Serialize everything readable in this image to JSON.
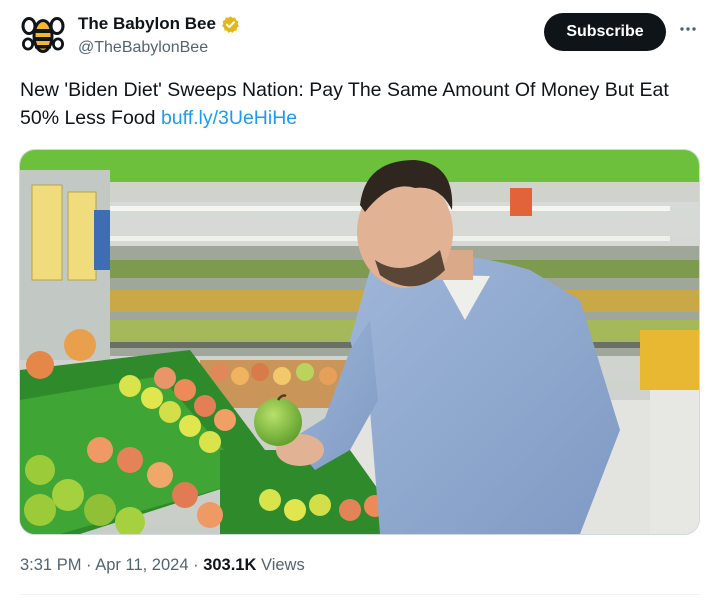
{
  "account": {
    "display_name": "The Babylon Bee",
    "handle": "@TheBabylonBee",
    "verified_badge_color": "#e2b719"
  },
  "actions": {
    "subscribe_label": "Subscribe",
    "more_icon": "more-horizontal-icon"
  },
  "tweet": {
    "text": "New 'Biden Diet' Sweeps Nation: Pay The Same Amount Of Money But Eat 50% Less Food",
    "link_text": "buff.ly/3UeHiHe"
  },
  "media": {
    "subject": "smiling man holding green apple in supermarket produce aisle"
  },
  "meta": {
    "time": "3:31 PM",
    "separator": "·",
    "date": "Apr 11, 2024",
    "views_count": "303.1K",
    "views_label": "Views"
  },
  "colors": {
    "link": "#1d9bf0",
    "text_primary": "#0f1419",
    "text_secondary": "#536471",
    "button_bg": "#0f1419"
  }
}
